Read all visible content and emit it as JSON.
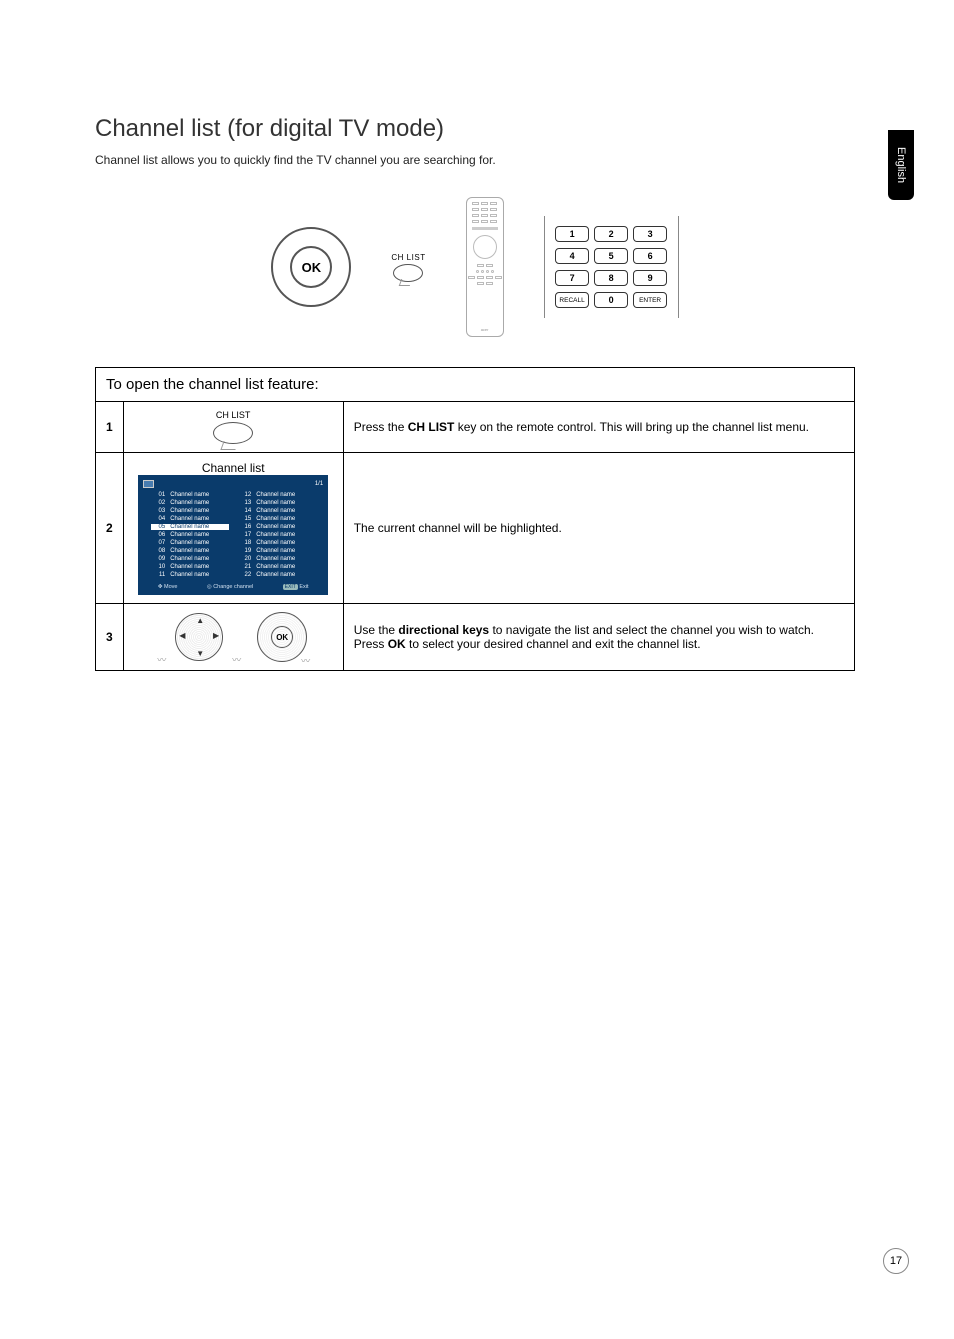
{
  "sideTab": "English",
  "pageNumber": "17",
  "title": "Channel list (for digital TV mode)",
  "intro": "Channel list allows you to quickly find the TV channel you are searching for.",
  "okLabel": "OK",
  "chListLabel": "CH LIST",
  "remoteBrand": "acer",
  "keypad": {
    "r1": [
      "1",
      "2",
      "3"
    ],
    "r2": [
      "4",
      "5",
      "6"
    ],
    "r3": [
      "7",
      "8",
      "9"
    ],
    "r4": [
      "RECALL",
      "0",
      "ENTER"
    ]
  },
  "tableHeader": "To open the channel list feature:",
  "steps": {
    "s1": {
      "num": "1",
      "desc_a": "Press the ",
      "desc_b": "CH LIST",
      "desc_c": " key on the remote control. This will bring up the channel list menu."
    },
    "s2": {
      "num": "2",
      "desc": "The current channel will be highlighted.",
      "screen": {
        "page": "1/1",
        "watermark": "Channel list",
        "chLabel": "Channel name",
        "col1": [
          "01",
          "02",
          "03",
          "04",
          "05",
          "06",
          "07",
          "08",
          "09",
          "10",
          "11"
        ],
        "col2": [
          "12",
          "13",
          "14",
          "15",
          "16",
          "17",
          "18",
          "19",
          "20",
          "21",
          "22"
        ],
        "selected": "05",
        "footer": {
          "move": "Move",
          "change": "Change channel",
          "exit": "Exit",
          "exitBtn": "EXIT"
        }
      }
    },
    "s3": {
      "num": "3",
      "desc_a": "Use the ",
      "desc_b": "directional keys",
      "desc_c": " to navigate the list and select the channel you wish to watch. Press ",
      "desc_d": "OK",
      "desc_e": " to select your desired channel and exit the channel list."
    }
  },
  "footerIcons": {
    "move": "✥",
    "change": "◎"
  }
}
